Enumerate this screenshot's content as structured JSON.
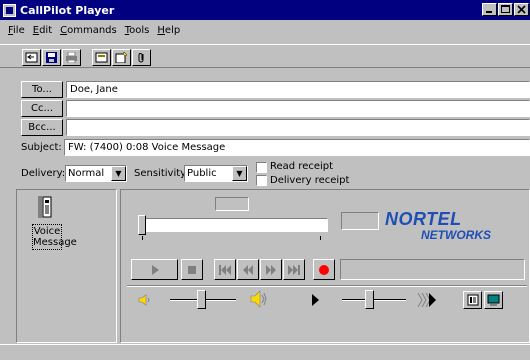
{
  "window": {
    "title": "CallPilot Player",
    "caption_buttons": [
      "minimize",
      "maximize",
      "close"
    ]
  },
  "menu": [
    "File",
    "Edit",
    "Commands",
    "Tools",
    "Help"
  ],
  "toolbar": {
    "icons": [
      "reply-icon",
      "save-icon",
      "print-icon",
      "forward-icon",
      "new-icon",
      "attach-icon"
    ]
  },
  "address": {
    "to_label": "To...",
    "to_value": "Doe, Jane",
    "cc_label": "Cc...",
    "cc_value": "",
    "bcc_label": "Bcc...",
    "bcc_value": ""
  },
  "subject": {
    "label": "Subject:",
    "value": "FW: (7400) 0:08 Voice Message"
  },
  "options": {
    "delivery_label": "Delivery:",
    "delivery_value": "Normal",
    "sensitivity_label": "Sensitivity:",
    "sensitivity_value": "Public",
    "read_receipt_label": "Read receipt",
    "delivery_receipt_label": "Delivery receipt"
  },
  "attachment": {
    "label_line1": "Voice",
    "label_line2": "Message"
  },
  "player": {
    "logo_main": "NORTEL",
    "logo_sub": "NETWORKS",
    "controls": [
      "play",
      "stop",
      "skip-to-start",
      "rewind",
      "fast-forward",
      "skip-to-end",
      "record"
    ]
  },
  "colors": {
    "titlebar": "#000080",
    "face": "#c0c0c0",
    "logo": "#1f4fb5",
    "record": "#ff0000"
  }
}
